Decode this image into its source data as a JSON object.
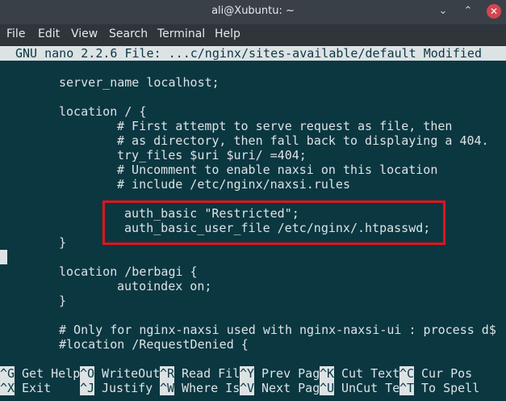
{
  "window": {
    "title": "ali@Xubuntu: ~",
    "minimize_glyph": "⌄",
    "maximize_glyph": "⌃",
    "close_glyph": "✕"
  },
  "menu": [
    "File",
    "Edit",
    "View",
    "Search",
    "Terminal",
    "Help"
  ],
  "nano_header": "GNU nano 2.2.6 File: ...c/nginx/sites-available/default Modified",
  "lines": [
    "server_name localhost;",
    "location / {",
    "# First attempt to serve request as file, then",
    "# as directory, then fall back to displaying a 404.",
    "try_files $uri $uri/ =404;",
    "# Uncomment to enable naxsi on this location",
    "# include /etc/nginx/naxsi.rules",
    "auth_basic \"Restricted\";",
    "auth_basic_user_file /etc/nginx/.htpasswd;",
    "}",
    "location /berbagi {",
    "autoindex on;",
    "}",
    "# Only for nginx-naxsi used with nginx-naxsi-ui : process d$",
    "#location /RequestDenied {"
  ],
  "shortcuts": {
    "row1": [
      {
        "key": "^G",
        "label": "Get Help"
      },
      {
        "key": "^O",
        "label": "WriteOut"
      },
      {
        "key": "^R",
        "label": "Read Fil"
      },
      {
        "key": "^Y",
        "label": "Prev Pag"
      },
      {
        "key": "^K",
        "label": "Cut Text"
      },
      {
        "key": "^C",
        "label": "Cur Pos"
      }
    ],
    "row2": [
      {
        "key": "^X",
        "label": "Exit"
      },
      {
        "key": "^J",
        "label": "Justify"
      },
      {
        "key": "^W",
        "label": "Where Is"
      },
      {
        "key": "^V",
        "label": "Next Pag"
      },
      {
        "key": "^U",
        "label": "UnCut Te"
      },
      {
        "key": "^T",
        "label": "To Spell"
      }
    ]
  },
  "colors": {
    "terminal_bg": "#0b3741",
    "terminal_fg": "#dde3e5",
    "highlight_box": "#e0151c",
    "titlebar_bg": "#3a4048",
    "menubar_bg": "#30353c",
    "close_button": "#d44550"
  }
}
